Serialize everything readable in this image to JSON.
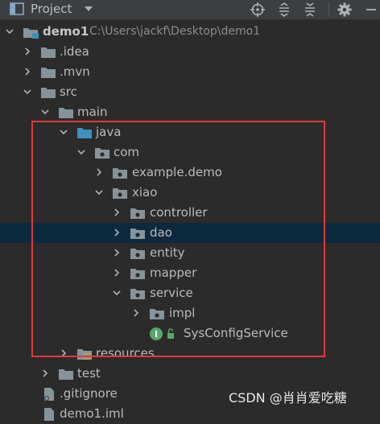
{
  "panel": {
    "title": "Project"
  },
  "toolbar": {
    "locate_icon": "crosshair-icon",
    "expand_icon": "expand-all-icon",
    "collapse_icon": "collapse-all-icon",
    "settings_icon": "gear-icon"
  },
  "tree": [
    {
      "label": "demo1",
      "path": "C:\\Users\\jackf\\Desktop\\demo1",
      "type": "project",
      "expanded": true
    },
    {
      "label": ".idea",
      "type": "folder",
      "expanded": false
    },
    {
      "label": ".mvn",
      "type": "folder",
      "expanded": false
    },
    {
      "label": "src",
      "type": "folder",
      "expanded": true
    },
    {
      "label": "main",
      "type": "folder",
      "expanded": true
    },
    {
      "label": "java",
      "type": "source-root",
      "expanded": true
    },
    {
      "label": "com",
      "type": "package",
      "expanded": true
    },
    {
      "label": "example.demo",
      "type": "package",
      "expanded": false
    },
    {
      "label": "xiao",
      "type": "package",
      "expanded": true
    },
    {
      "label": "controller",
      "type": "package",
      "expanded": false
    },
    {
      "label": "dao",
      "type": "package",
      "expanded": false,
      "selected": true
    },
    {
      "label": "entity",
      "type": "package",
      "expanded": false
    },
    {
      "label": "mapper",
      "type": "package",
      "expanded": false
    },
    {
      "label": "service",
      "type": "package",
      "expanded": true
    },
    {
      "label": "impl",
      "type": "package",
      "expanded": false
    },
    {
      "label": "SysConfigService",
      "type": "interface"
    },
    {
      "label": "resources",
      "type": "resources-root",
      "expanded": false
    },
    {
      "label": "test",
      "type": "folder",
      "expanded": false
    },
    {
      "label": ".gitignore",
      "type": "file"
    },
    {
      "label": "demo1.iml",
      "type": "file"
    }
  ],
  "colors": {
    "background": "#2b2b2b",
    "header": "#3c3f41",
    "selection": "#0d293e",
    "highlight_box": "#e0393e",
    "source_folder": "#3d8fbf",
    "interface_badge": "#59a869"
  },
  "watermark": "CSDN @肖肖爱吃糖"
}
